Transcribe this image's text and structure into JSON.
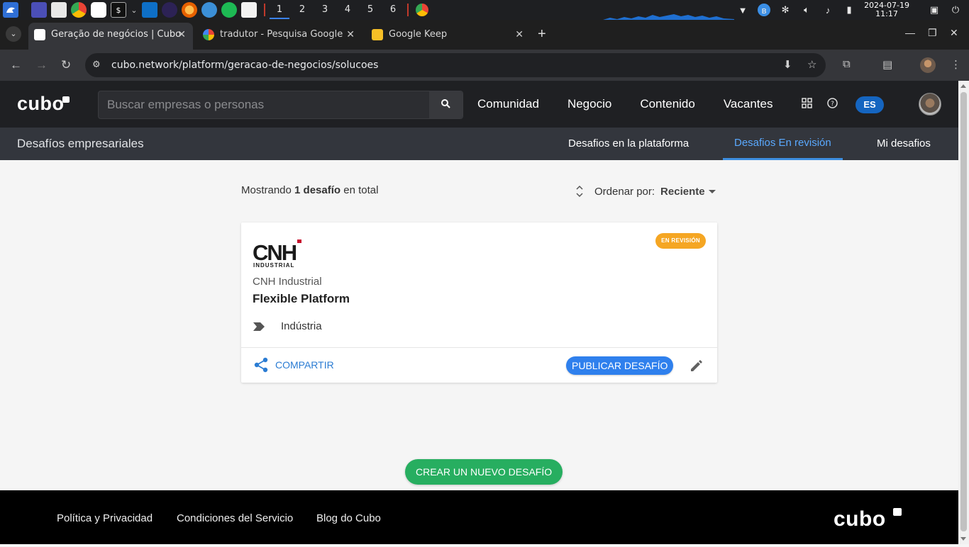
{
  "taskbar": {
    "workspaces": [
      "1",
      "2",
      "3",
      "4",
      "5",
      "6"
    ],
    "active_workspace": "1",
    "date": "2024-07-19",
    "time": "11:17"
  },
  "browser": {
    "tabs": [
      {
        "title": "Geração de negócios | Cubo",
        "active": true
      },
      {
        "title": "tradutor - Pesquisa Google",
        "active": false
      },
      {
        "title": "Google Keep",
        "active": false
      }
    ],
    "url": "cubo.network/platform/geracao-de-negocios/solucoes"
  },
  "header": {
    "logo": "cubo",
    "search_placeholder": "Buscar empresas o personas",
    "nav": [
      "Comunidad",
      "Negocio",
      "Contenido",
      "Vacantes"
    ],
    "language": "ES"
  },
  "subnav": {
    "title": "Desafíos empresariales",
    "tabs": [
      {
        "label": "Desafios en la plataforma",
        "active": false
      },
      {
        "label": "Desafios En revisión",
        "active": true
      },
      {
        "label": "Mi desafios",
        "active": false
      }
    ]
  },
  "listing": {
    "showing_prefix": "Mostrando",
    "showing_count": "1 desafío",
    "showing_suffix": "en total",
    "sort_label": "Ordenar por:",
    "sort_value": "Reciente"
  },
  "card": {
    "status_badge": "EN REVISIÓN",
    "logo_text": "CNH",
    "logo_subtext": "INDUSTRIAL",
    "company": "CNH Industrial",
    "title": "Flexible Platform",
    "tag": "Indústria",
    "share_label": "COMPARTIR",
    "publish_label": "PUBLICAR DESAFÍO"
  },
  "create_button": "CREAR UN NUEVO DESAFÍO",
  "footer": {
    "links": [
      "Política y Privacidad",
      "Condiciones del Servicio",
      "Blog do Cubo"
    ],
    "logo": "cubo"
  },
  "colors": {
    "header_bg": "#1f2023",
    "accent_blue": "#2f80ed",
    "active_tab": "#5aa9ff",
    "badge_orange": "#f5a623",
    "create_green": "#27ae60"
  }
}
